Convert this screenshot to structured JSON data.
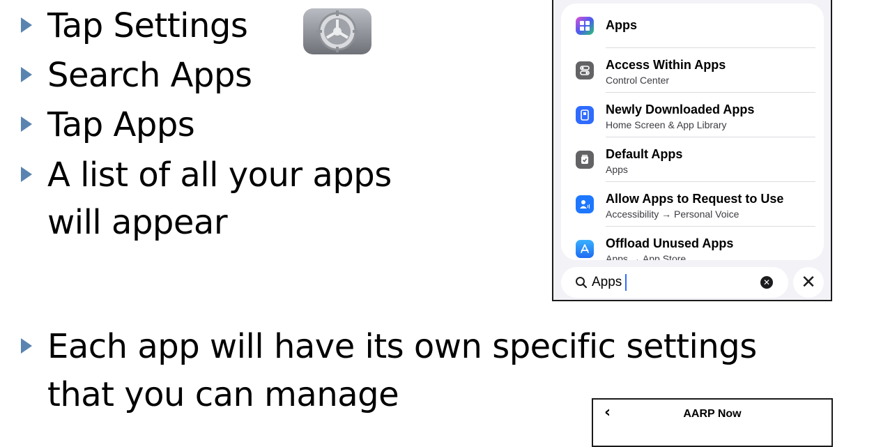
{
  "bullets": [
    "Tap Settings",
    "Search Apps",
    "Tap Apps",
    "A list of all your apps",
    "will appear",
    "Each app will have its own specific settings",
    "that you can manage"
  ],
  "icons": {
    "settings": "gear-icon",
    "search": "magnifying-glass-icon",
    "clear": "clear-circle-icon",
    "close": "close-icon",
    "back": "chevron-left-icon"
  },
  "search_results": [
    {
      "title": "Apps",
      "subtitle": "",
      "icon": "apps-grid-icon",
      "color": "#6a4cf0"
    },
    {
      "title": "Access Within Apps",
      "subtitle": "Control Center",
      "icon": "toggles-icon",
      "color": "#636366"
    },
    {
      "title": "Newly Downloaded Apps",
      "subtitle": "Home Screen & App Library",
      "icon": "phone-icon",
      "color": "#2f6bff"
    },
    {
      "title": "Default Apps",
      "subtitle": "Apps",
      "icon": "default-app-icon",
      "color": "#636366"
    },
    {
      "title": "Allow Apps to Request to Use",
      "subtitle": "Accessibility → Personal Voice",
      "icon": "accessibility-icon",
      "color": "#1e78ff"
    },
    {
      "title": "Offload Unused Apps",
      "subtitle": "Apps → App Store",
      "icon": "app-store-icon",
      "color": "#1d8bff"
    }
  ],
  "search": {
    "value": "Apps"
  },
  "app_header": {
    "title": "AARP Now"
  },
  "colors": {
    "bullet_arrow": "#5a84b0",
    "search_caret": "#2f6bff"
  }
}
